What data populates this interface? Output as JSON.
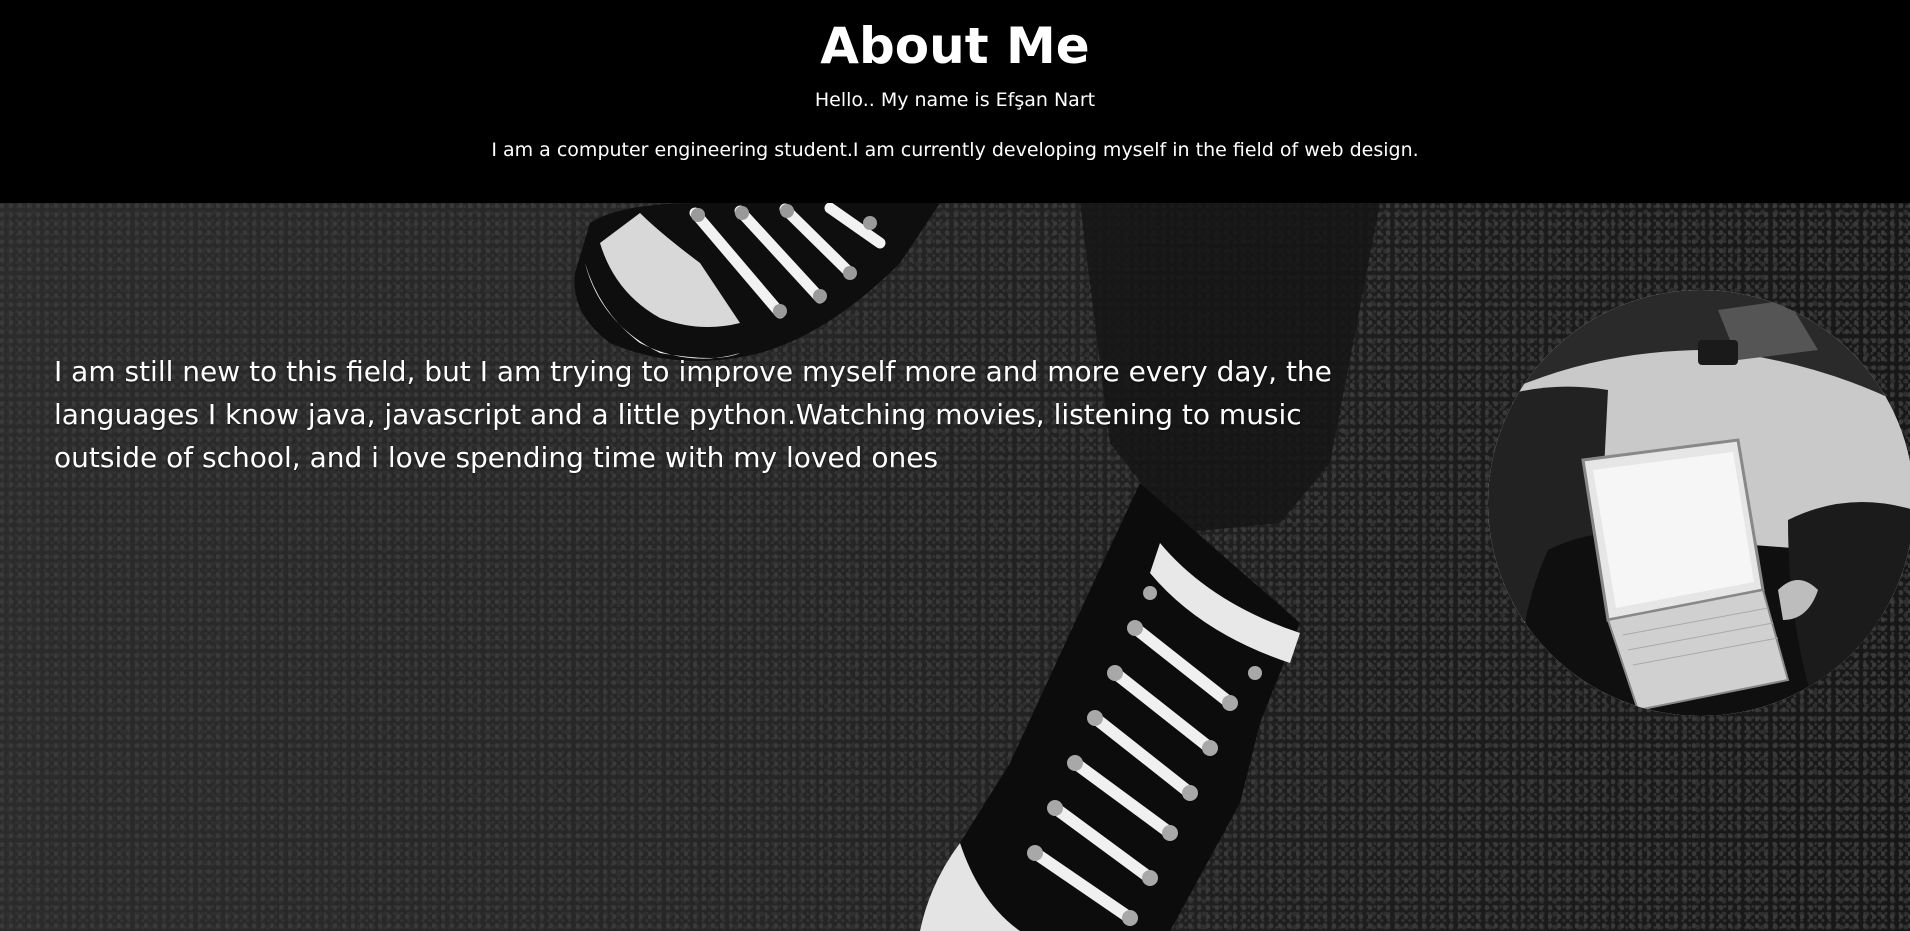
{
  "header": {
    "title": "About Me",
    "greeting": "Hello.. My name is Efşan Nart",
    "intro": "I am a computer engineering student.I am currently developing myself in the field of web design."
  },
  "main": {
    "about_paragraph": "I am still new to this field, but I am trying to improve myself more and more every day, the languages I know java, javascript and a little python.Watching movies, listening to music outside of school, and i love spending time with my loved ones"
  },
  "images": {
    "background": "sneakers-on-asphalt-photo",
    "profile": "laptop-in-car-photo"
  },
  "colors": {
    "header_bg": "#000000",
    "text": "#ffffff"
  }
}
